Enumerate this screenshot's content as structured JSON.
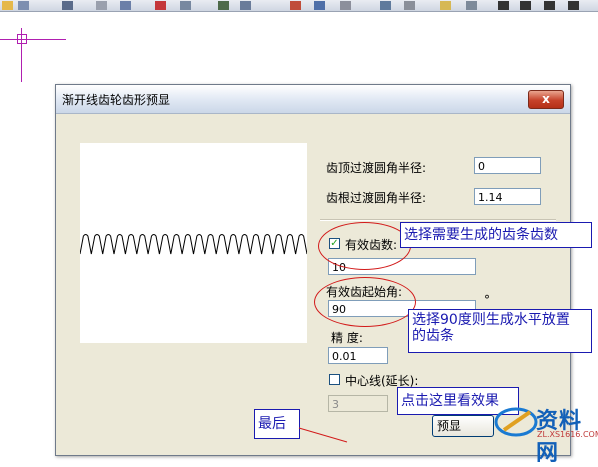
{
  "dialog": {
    "title": "渐开线齿轮齿形预显",
    "close_label": "x",
    "tip_fillet_label": "齿顶过渡圆角半径:",
    "tip_fillet_value": "0",
    "root_fillet_label": "齿根过渡圆角半径:",
    "root_fillet_value": "1.14",
    "effective_teeth_label": "有效齿数:",
    "effective_teeth_checked": true,
    "effective_teeth_value": "10",
    "start_angle_label": "有效齿起始角:",
    "start_angle_value": "90",
    "degree_unit": "°",
    "precision_label": "精 度:",
    "precision_value": "0.01",
    "centerline_label": "中心线(延长):",
    "centerline_checked": false,
    "centerline_value": "3",
    "preview_button_label": "预显"
  },
  "annotations": {
    "teeth_note": "选择需要生成的齿条齿数",
    "angle_note_line1": "选择90度则生成水平放置",
    "angle_note_line2": "的齿条",
    "preview_note": "点击这里看效果",
    "last_note": "最后"
  },
  "watermark": {
    "brand": "资料网",
    "url": "ZL.XS1616.COM"
  },
  "preview": {
    "rack_teeth_shown": 20
  },
  "colors": {
    "annotation_blue": "#1a1ab0",
    "ellipse_red": "#d21a1a",
    "crosshair_magenta": "#b01fb0",
    "dialog_bg": "#ece9d8"
  }
}
